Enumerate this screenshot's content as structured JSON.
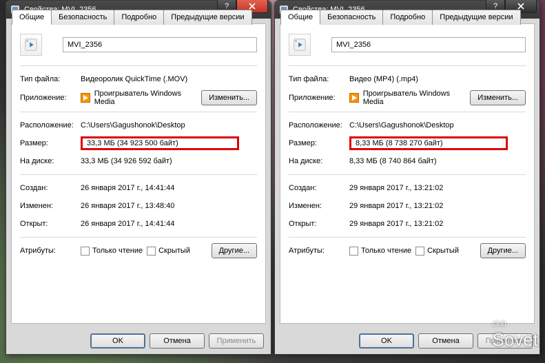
{
  "tabs": {
    "general": "Общие",
    "security": "Безопасность",
    "details": "Подробно",
    "previous": "Предыдущие версии"
  },
  "labels": {
    "prop_prefix": "Свойства: ",
    "filetype": "Тип файла:",
    "app": "Приложение:",
    "change": "Изменить...",
    "location": "Расположение:",
    "size": "Размер:",
    "ondisk": "На диске:",
    "created": "Создан:",
    "modified": "Изменен:",
    "opened": "Открыт:",
    "attributes": "Атрибуты:",
    "readonly": "Только чтение",
    "hidden": "Скрытый",
    "other": "Другие...",
    "ok": "OK",
    "cancel": "Отмена",
    "apply": "Применить"
  },
  "left": {
    "title": "MVI_2356",
    "filename": "MVI_2356",
    "filetype": "Видеоролик QuickTime (.MOV)",
    "app": "Проигрыватель Windows Media",
    "location": "C:\\Users\\Gagushonok\\Desktop",
    "size": "33,3 МБ (34 923 500 байт)",
    "ondisk": "33,3 МБ (34 926 592 байт)",
    "created": "26 января 2017 г., 14:41:44",
    "modified": "26 января 2017 г., 13:48:40",
    "opened": "26 января 2017 г., 14:41:44",
    "close_style": "red"
  },
  "right": {
    "title": "MVI_2356",
    "filename": "MVI_2356",
    "filetype": "Видео (MP4) (.mp4)",
    "app": "Проигрыватель Windows Media",
    "location": "C:\\Users\\Gagushonok\\Desktop",
    "size": "8,33 МБ (8 738 270 байт)",
    "ondisk": "8,33 МБ (8 740 864 байт)",
    "created": "29 января 2017 г., 13:21:02",
    "modified": "29 января 2017 г., 13:21:02",
    "opened": "29 января 2017 г., 13:21:02",
    "close_style": "grey"
  },
  "watermark": {
    "top": "club",
    "bottom": "Sovet"
  }
}
